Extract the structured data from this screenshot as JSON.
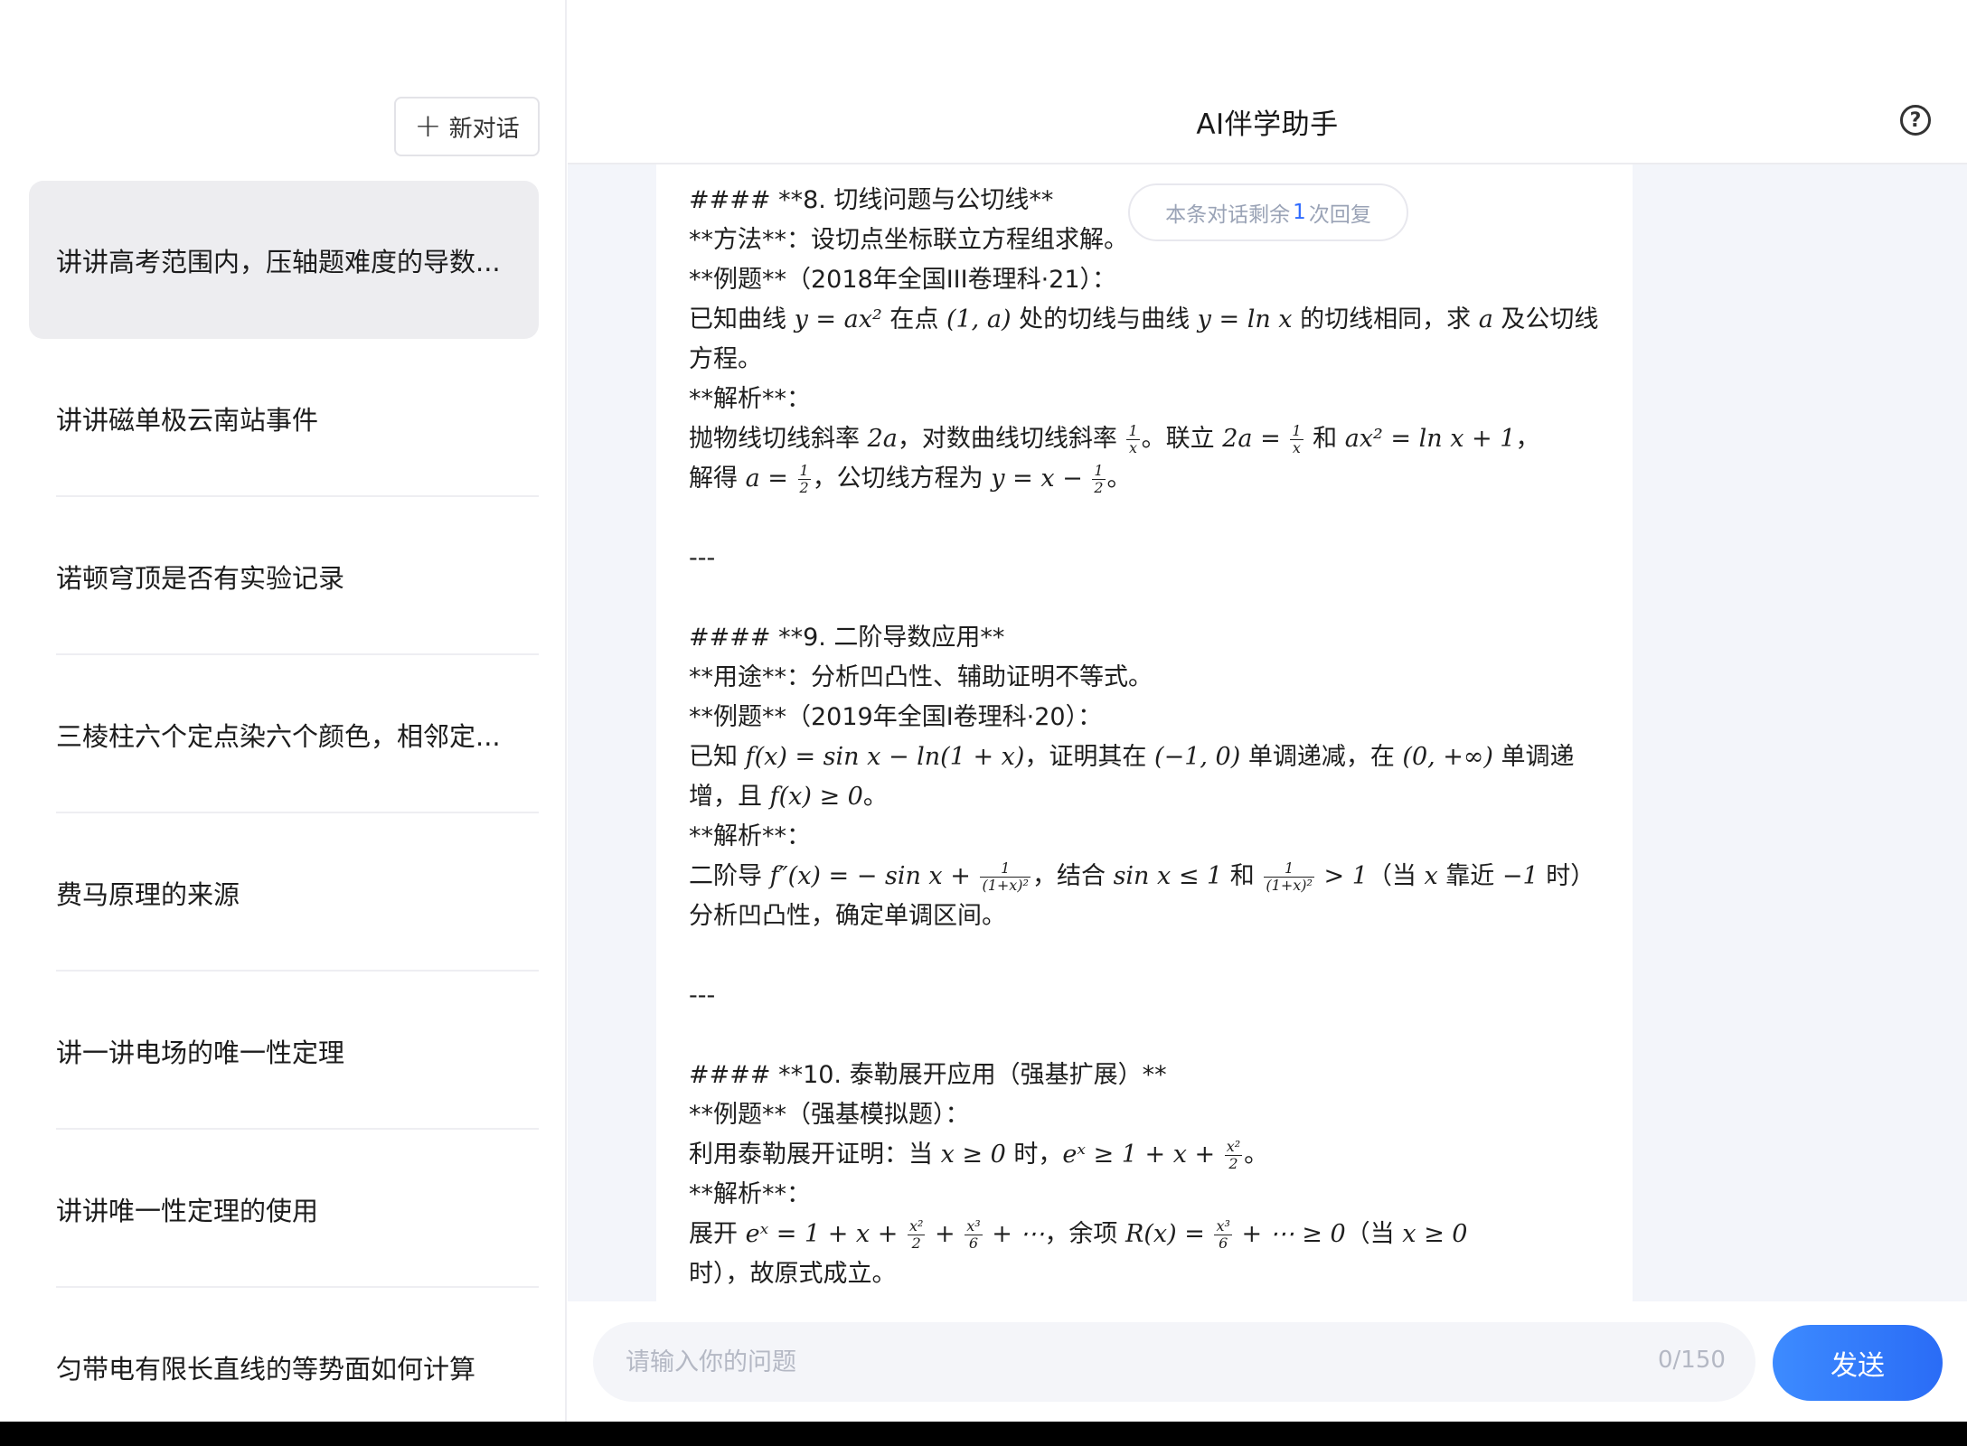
{
  "header": {
    "title": "AI伴学助手",
    "help_icon": "help-icon"
  },
  "sidebar": {
    "new_chat_label": "新对话",
    "items": [
      {
        "label": "讲讲高考范围内，压轴题难度的导数...",
        "active": true
      },
      {
        "label": "讲讲磁单极云南站事件"
      },
      {
        "label": "诺顿穹顶是否有实验记录"
      },
      {
        "label": "三棱柱六个定点染六个颜色，相邻定..."
      },
      {
        "label": "费马原理的来源"
      },
      {
        "label": "讲一讲电场的唯一性定理"
      },
      {
        "label": "讲讲唯一性定理的使用"
      },
      {
        "label": "匀带电有限长直线的等势面如何计算"
      }
    ]
  },
  "badge": {
    "prefix": "本条对话剩余",
    "count": "1",
    "suffix": "次回复"
  },
  "message": {
    "s8_heading": "#### **8. 切线问题与公切线**",
    "s8_method": "**方法**：设切点坐标联立方程组求解。",
    "s8_example": "**例题**（2018年全国III卷理科·21）：",
    "s8_problem_a": "已知曲线 ",
    "s8_problem_m1": "y = ax²",
    "s8_problem_b": " 在点 ",
    "s8_problem_m2": "(1, a)",
    "s8_problem_c": " 处的切线与曲线 ",
    "s8_problem_m3": "y = ln x",
    "s8_problem_d": " 的切线相同，求 ",
    "s8_problem_m4": "a",
    "s8_problem_e": " 及公切线方程。",
    "s8_analysis": "**解析**：",
    "s8_sol1_a": "抛物线切线斜率 ",
    "s8_sol1_m1": "2a",
    "s8_sol1_b": "，对数曲线切线斜率 ",
    "s8_sol1_c": "。联立 ",
    "s8_sol1_m2": "2a =",
    "s8_sol1_d": " 和 ",
    "s8_sol1_m3": "ax² = ln x + 1",
    "s8_sol1_e": "，",
    "s8_sol2_a": "解得 ",
    "s8_sol2_m1": "a =",
    "s8_sol2_b": "，公切线方程为 ",
    "s8_sol2_m2": "y = x −",
    "s8_sol2_c": "。",
    "sep1": "---",
    "s9_heading": "#### **9. 二阶导数应用**",
    "s9_use": "**用途**：分析凹凸性、辅助证明不等式。",
    "s9_example": "**例题**（2019年全国I卷理科·20）：",
    "s9_problem_a": "已知 ",
    "s9_problem_m1": "f(x) = sin x − ln(1 + x)",
    "s9_problem_b": "，证明其在 ",
    "s9_problem_m2": "(−1, 0)",
    "s9_problem_c": " 单调递减，在 ",
    "s9_problem_m3": "(0, +∞)",
    "s9_problem_d": " 单调递增，且 ",
    "s9_problem_m4": "f(x) ≥ 0",
    "s9_problem_e": "。",
    "s9_analysis": "**解析**：",
    "s9_sol_a": "二阶导 ",
    "s9_sol_m1": "f″(x) = − sin x +",
    "s9_sol_b": "，结合 ",
    "s9_sol_m2": "sin x ≤ 1",
    "s9_sol_c": " 和 ",
    "s9_sol_m3": "> 1",
    "s9_sol_d": "（当 ",
    "s9_sol_m4": "x",
    "s9_sol_e": " 靠近 ",
    "s9_sol_m5": "−1",
    "s9_sol_f": " 时）分析凹凸性，确定单调区间。",
    "sep2": "---",
    "s10_heading": "#### **10. 泰勒展开应用（强基扩展）**",
    "s10_example": "**例题**（强基模拟题）：",
    "s10_problem_a": "利用泰勒展开证明：当 ",
    "s10_problem_m1": "x ≥ 0",
    "s10_problem_b": " 时，",
    "s10_problem_m2": "eˣ ≥ 1 + x +",
    "s10_problem_c": "。",
    "s10_analysis": "**解析**：",
    "s10_sol_a": "展开 ",
    "s10_sol_m1": "eˣ = 1 + x +",
    "s10_sol_m2": "+",
    "s10_sol_m3": "+ ⋯",
    "s10_sol_b": "，余项 ",
    "s10_sol_m4": "R(x) =",
    "s10_sol_m5": "+ ⋯ ≥ 0",
    "s10_sol_c": "（当 ",
    "s10_sol_m6": "x ≥ 0",
    "s10_sol_d": "时），故原式成立。",
    "frac_one": "1",
    "frac_two": "2",
    "frac_x": "x",
    "frac_1px2": "(1+x)²",
    "frac_x2": "x²",
    "frac_x3": "x³",
    "frac_six": "6"
  },
  "input": {
    "placeholder": "请输入你的问题",
    "counter": "0/150",
    "send_label": "发送"
  },
  "colors": {
    "accent": "#2f6bff",
    "send_gradient_start": "#3d8bff",
    "send_gradient_end": "#2a6cf6",
    "sidebar_active": "#ededf0",
    "chat_bg": "#f3f5fa"
  }
}
